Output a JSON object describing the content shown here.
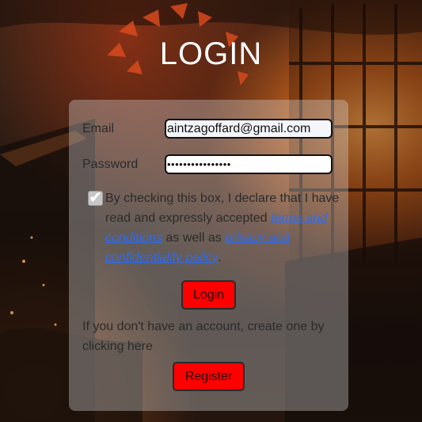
{
  "page": {
    "title": "LOGIN"
  },
  "form": {
    "email_label": "Email",
    "email_value": "aintzagoffard@gmail.com",
    "password_label": "Password",
    "password_value": "••••••••••••••••",
    "consent": {
      "checked": true,
      "check_glyph": "✔",
      "text_before": "By checking this box, I declare that I have read and expressly accepted ",
      "terms_link": "terms and conditions",
      "text_middle": " as well as ",
      "privacy_link": "privacy and confidentiality policy",
      "text_after": "."
    },
    "login_button": "Login",
    "signup_text": "If you don't have an account, create one by clicking here",
    "register_button": "Register"
  },
  "colors": {
    "button_red": "#ff0000",
    "link_blue": "#2d6cf0",
    "panel": "rgba(215,215,215,0.36)"
  }
}
